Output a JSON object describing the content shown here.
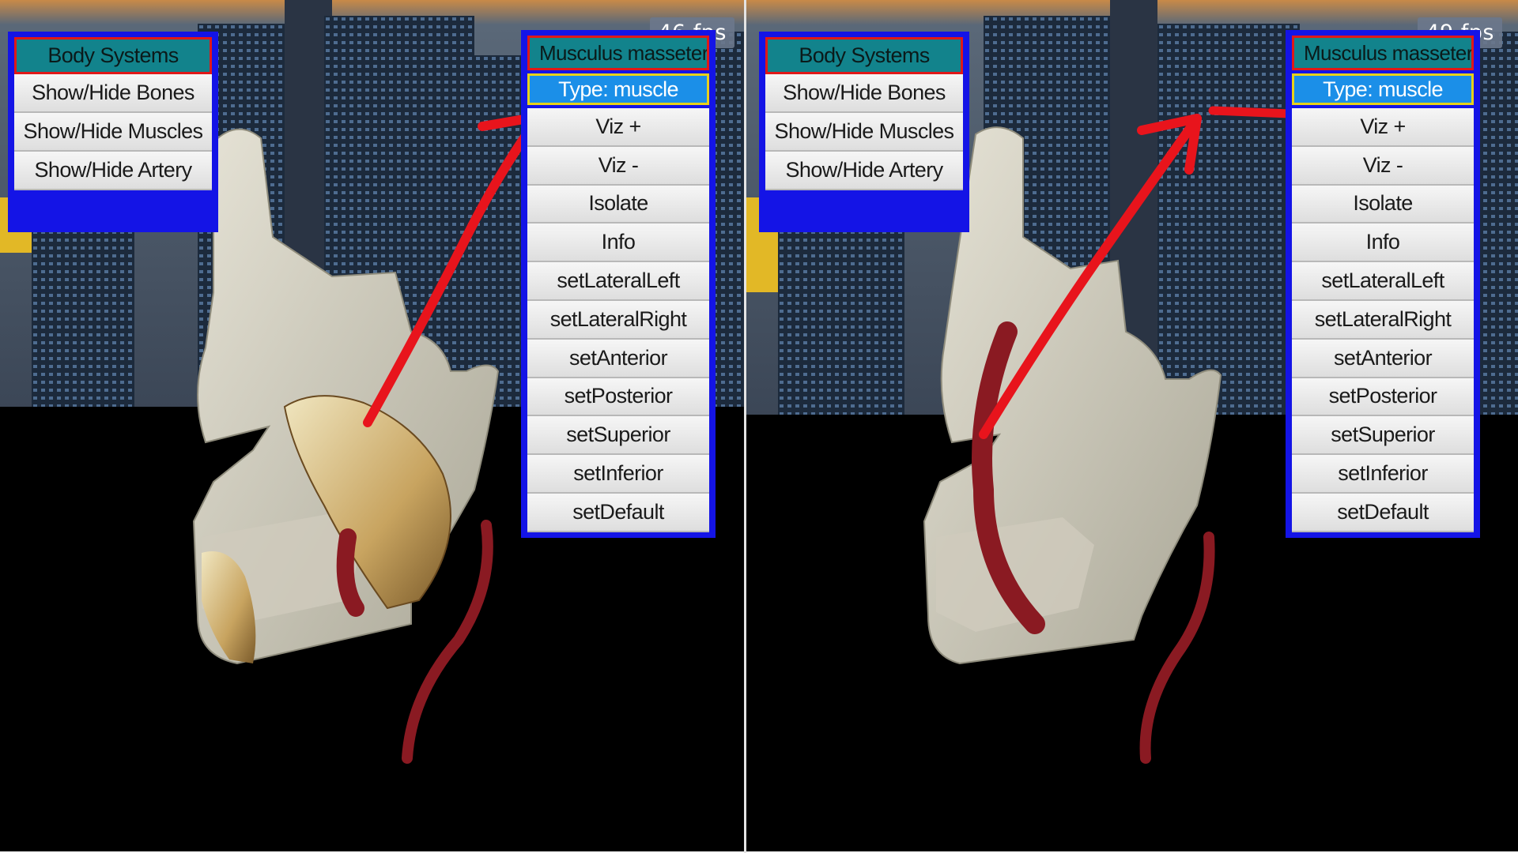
{
  "views": [
    {
      "fps": "46 fps",
      "systems_panel": {
        "title": "Body Systems",
        "items": [
          "Show/Hide Bones",
          "Show/Hide Muscles",
          "Show/Hide Artery"
        ]
      },
      "organ_panel": {
        "name": "Musculus masseter",
        "type": "Type: muscle",
        "buttons": [
          "Viz +",
          "Viz -",
          "Isolate",
          "Info",
          "setLateralLeft",
          "setLateralRight",
          "setAnterior",
          "setPosterior",
          "setSuperior",
          "setInferior",
          "setDefault"
        ]
      }
    },
    {
      "fps": "49 fps",
      "systems_panel": {
        "title": "Body Systems",
        "items": [
          "Show/Hide Bones",
          "Show/Hide Muscles",
          "Show/Hide Artery"
        ]
      },
      "organ_panel": {
        "name": "Musculus masseter",
        "type": "Type: muscle",
        "buttons": [
          "Viz +",
          "Viz -",
          "Isolate",
          "Info",
          "setLateralLeft",
          "setLateralRight",
          "setAnterior",
          "setPosterior",
          "setSuperior",
          "setInferior",
          "setDefault"
        ]
      }
    }
  ],
  "colors": {
    "panel_border": "#1414e6",
    "header_bg": "#12838c",
    "header_outline": "#e01818",
    "type_bg": "#1b8fe8",
    "type_outline": "#e8d21a",
    "annotation_arrow": "#e8141c",
    "bone": "#d9d6c8",
    "artery": "#8a1a22"
  }
}
